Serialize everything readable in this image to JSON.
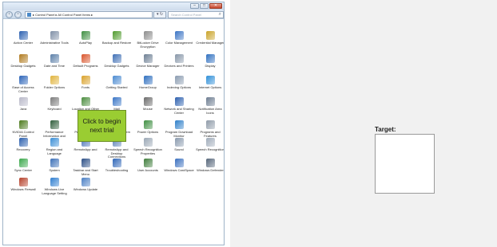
{
  "window": {
    "controls": {
      "minimize": "–",
      "maximize": "□",
      "close": "✕"
    },
    "nav": {
      "back": "‹",
      "forward": "›"
    },
    "address_text": "▸ Control Panel ▸ All Control Panel Items ▸",
    "refresh_label": "▾ ↻",
    "search_placeholder": "Search Control Panel",
    "search_icon": "⌕"
  },
  "items": [
    {
      "label": "Action Center",
      "icon": "flag-icon",
      "color": "#2a5fb0"
    },
    {
      "label": "Administrative Tools",
      "icon": "tools-icon",
      "color": "#7f8fa6"
    },
    {
      "label": "AutoPlay",
      "icon": "autoplay-icon",
      "color": "#3e8e41"
    },
    {
      "label": "Backup and Restore",
      "icon": "backup-icon",
      "color": "#4f9a2d"
    },
    {
      "label": "BitLocker Drive Encryption",
      "icon": "bitlocker-icon",
      "color": "#8c8c8c"
    },
    {
      "label": "Color Management",
      "icon": "color-icon",
      "color": "#3a73c4"
    },
    {
      "label": "Credential Manager",
      "icon": "credential-icon",
      "color": "#c9a227"
    },
    {
      "label": "Desktop Gadgets",
      "icon": "gadgets-icon",
      "color": "#b07a1e"
    },
    {
      "label": "Date and Time",
      "icon": "clock-icon",
      "color": "#5b7fa8"
    },
    {
      "label": "Default Programs",
      "icon": "default-programs-icon",
      "color": "#d9542b"
    },
    {
      "label": "Desktop Gadgets",
      "icon": "gadgets-icon",
      "color": "#3f6fb5"
    },
    {
      "label": "Device Manager",
      "icon": "device-manager-icon",
      "color": "#6d7f93"
    },
    {
      "label": "Devices and Printers",
      "icon": "printer-icon",
      "color": "#8796a8"
    },
    {
      "label": "Display",
      "icon": "display-icon",
      "color": "#2f6fc0"
    },
    {
      "label": "Ease of Access Center",
      "icon": "ease-icon",
      "color": "#2b63b8"
    },
    {
      "label": "Folder Options",
      "icon": "folder-icon",
      "color": "#e0b33c"
    },
    {
      "label": "Fonts",
      "icon": "fonts-icon",
      "color": "#d9a12a"
    },
    {
      "label": "Getting Started",
      "icon": "getting-started-icon",
      "color": "#4b8bd1"
    },
    {
      "label": "HomeGroup",
      "icon": "homegroup-icon",
      "color": "#2e6fbf"
    },
    {
      "label": "Indexing Options",
      "icon": "indexing-icon",
      "color": "#8a9bb0"
    },
    {
      "label": "Internet Options",
      "icon": "internet-icon",
      "color": "#2f8fd8"
    },
    {
      "label": "Java",
      "icon": "java-icon",
      "color": "#b8b8c8"
    },
    {
      "label": "Keyboard",
      "icon": "keyboard-icon",
      "color": "#7b7b7b"
    },
    {
      "label": "Location and Other Sensors",
      "icon": "location-icon",
      "color": "#4a8c3e"
    },
    {
      "label": "Mail",
      "icon": "mail-icon",
      "color": "#3975c6"
    },
    {
      "label": "Mouse",
      "icon": "mouse-icon",
      "color": "#6a6a6a"
    },
    {
      "label": "Network and Sharing Center",
      "icon": "network-icon",
      "color": "#2c5fae"
    },
    {
      "label": "Notification Area Icons",
      "icon": "notification-icon",
      "color": "#6c7c90"
    },
    {
      "label": "NVIDIA Control Panel",
      "icon": "nvidia-icon",
      "color": "#4b7a1b"
    },
    {
      "label": "Performance Information and Tools",
      "icon": "performance-icon",
      "color": "#2f5d3a"
    },
    {
      "label": "Personalization",
      "icon": "personalization-icon",
      "color": "#4a7fc4"
    },
    {
      "label": "Phone and Modem",
      "icon": "phone-icon",
      "color": "#7d8a99"
    },
    {
      "label": "Power Options",
      "icon": "power-icon",
      "color": "#3e8e41"
    },
    {
      "label": "Program Download Monitor",
      "icon": "download-icon",
      "color": "#2f7fc9"
    },
    {
      "label": "Programs and Features",
      "icon": "programs-icon",
      "color": "#8e9aa8"
    },
    {
      "label": "Recovery",
      "icon": "recovery-icon",
      "color": "#2b5fae"
    },
    {
      "label": "Region and Language",
      "icon": "region-icon",
      "color": "#3a8ed6"
    },
    {
      "label": "RemoteApp and",
      "icon": "remoteapp-icon",
      "color": "#4a72b8"
    },
    {
      "label": "RemoteApp and Desktop Connections",
      "icon": "remote-desktop-icon",
      "color": "#5a7fb5"
    },
    {
      "label": "Speech Recognition Properties",
      "icon": "speech-icon",
      "color": "#9aa7b5"
    },
    {
      "label": "Sound",
      "icon": "sound-icon",
      "color": "#8a9aae"
    },
    {
      "label": "Speech Recognition",
      "icon": "microphone-icon",
      "color": "#a0acba"
    },
    {
      "label": "Sync Center",
      "icon": "sync-icon",
      "color": "#3aa84a"
    },
    {
      "label": "System",
      "icon": "system-icon",
      "color": "#3b6fb8"
    },
    {
      "label": "Taskbar and Start Menu",
      "icon": "taskbar-icon",
      "color": "#2c4f86"
    },
    {
      "label": "Troubleshooting",
      "icon": "troubleshooting-icon",
      "color": "#2f66b8"
    },
    {
      "label": "User Accounts",
      "icon": "user-accounts-icon",
      "color": "#3e7c3a"
    },
    {
      "label": "Windows CardSpace",
      "icon": "cardspace-icon",
      "color": "#3a6fbf"
    },
    {
      "label": "Windows Defender",
      "icon": "defender-icon",
      "color": "#56667a"
    },
    {
      "label": "Windows Firewall",
      "icon": "firewall-icon",
      "color": "#b5402a"
    },
    {
      "label": "Windows Live Language Setting",
      "icon": "windows-live-icon",
      "color": "#2e7ed0"
    },
    {
      "label": "Windows Update",
      "icon": "windows-update-icon",
      "color": "#4a7fc4"
    }
  ],
  "overlay": {
    "line1": "Click to begin",
    "line2": "next trial"
  },
  "target": {
    "label": "Target:"
  },
  "colors": {
    "overlay_bg": "#9acd32",
    "right_panel_bg": "#f1f1f1"
  }
}
